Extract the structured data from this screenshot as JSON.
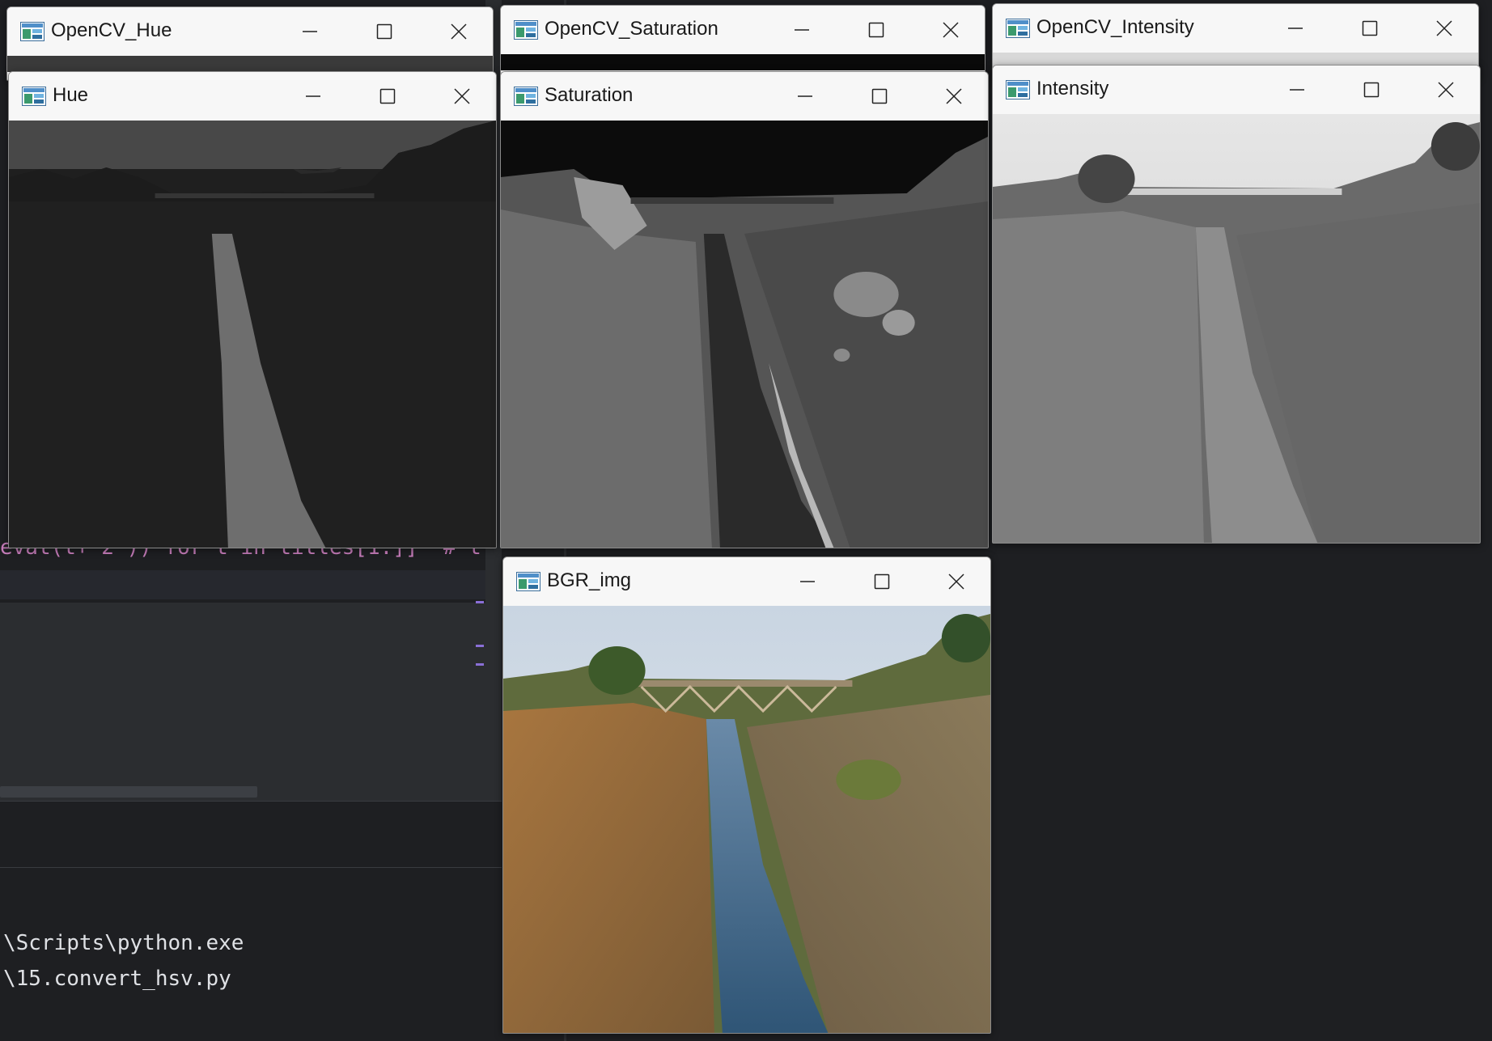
{
  "terminal": {
    "lines": [
      "\\Scripts\\python.exe",
      "\\15.convert_hsv.py"
    ]
  },
  "code": {
    "fragment": "evat(t+ 2 )) for t in titles[1:]]  # t"
  },
  "windows": [
    {
      "id": "opencv_hue",
      "title": "OpenCV_Hue"
    },
    {
      "id": "opencv_saturation",
      "title": "OpenCV_Saturation"
    },
    {
      "id": "opencv_intensity",
      "title": "OpenCV_Intensity"
    },
    {
      "id": "hue",
      "title": "Hue"
    },
    {
      "id": "saturation",
      "title": "Saturation"
    },
    {
      "id": "intensity",
      "title": "Intensity"
    },
    {
      "id": "bgr_img",
      "title": "BGR_img"
    }
  ],
  "colors": {
    "ide_background": "#1e1f22",
    "titlebar": "#f7f7f7",
    "accent_marker": "#8a6fd6"
  },
  "icons": {
    "window_app": "opencv-window-icon",
    "minimize": "minimize-icon",
    "maximize": "maximize-icon",
    "close": "close-icon"
  }
}
